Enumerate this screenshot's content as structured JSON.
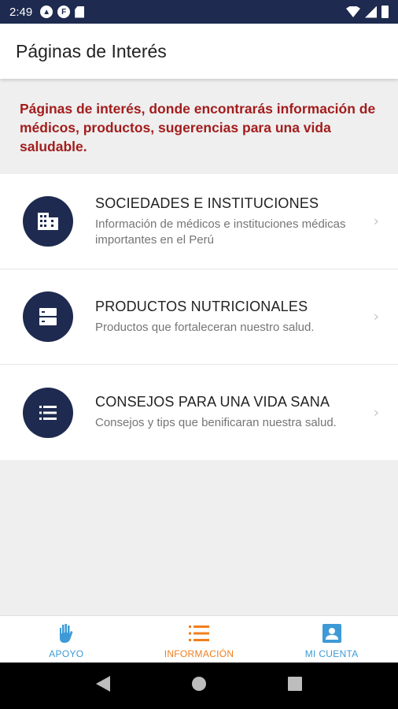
{
  "status_bar": {
    "time": "2:49",
    "left_icons": [
      "a-circle-icon",
      "f-circle-icon",
      "sd-card-icon"
    ],
    "right_icons": [
      "wifi-icon",
      "signal-icon",
      "battery-icon"
    ]
  },
  "app_bar": {
    "title": "Páginas de Interés"
  },
  "intro": {
    "text": "Páginas de interés, donde encontrarás información de médicos, productos, sugerencias para una vida saludable."
  },
  "items": [
    {
      "icon": "building-icon",
      "title": "SOCIEDADES E INSTITUCIONES",
      "subtitle": "Información de médicos e instituciones médicas importantes en el Perú"
    },
    {
      "icon": "storage-icon",
      "title": "PRODUCTOS NUTRICIONALES",
      "subtitle": "Productos que fortaleceran nuestro salud."
    },
    {
      "icon": "list-icon",
      "title": "CONSEJOS PARA UNA VIDA SANA",
      "subtitle": "Consejos y tips que benificaran nuestra salud."
    }
  ],
  "bottom_nav": [
    {
      "label": "APOYO",
      "icon": "hand-icon",
      "active": false
    },
    {
      "label": "INFORMACIÓN",
      "icon": "list-icon",
      "active": true
    },
    {
      "label": "MI CUENTA",
      "icon": "account-box-icon",
      "active": false
    }
  ],
  "colors": {
    "primary": "#1e2a4f",
    "accent_red": "#a31d1d",
    "nav_blue": "#3d9ad6",
    "nav_active": "#f07f1e",
    "background": "#efefef"
  }
}
